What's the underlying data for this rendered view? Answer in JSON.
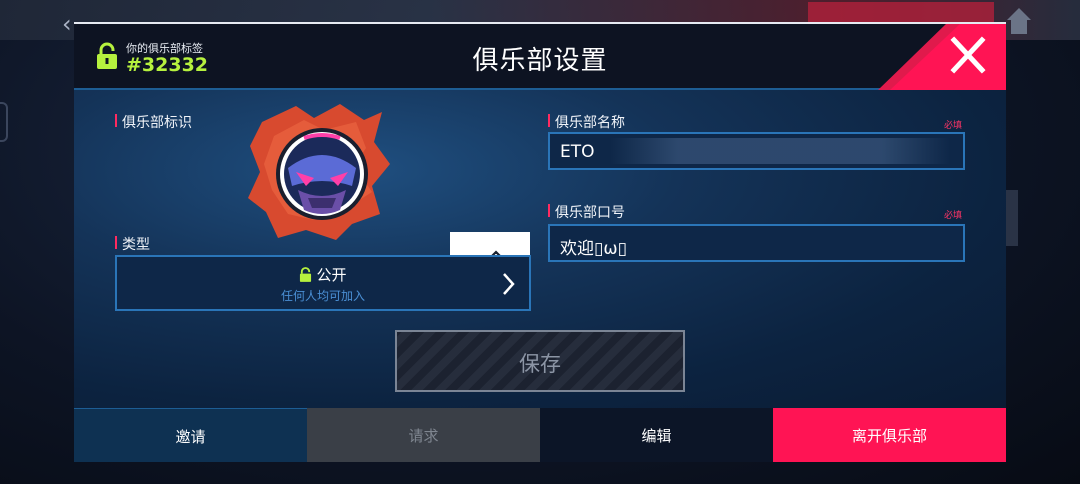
{
  "background": {
    "back_glyph": "‹"
  },
  "header": {
    "tag_label": "你的俱乐部标签",
    "tag_value": "#32332",
    "title": "俱乐部设置",
    "close_icon": "close-x-icon"
  },
  "emblem_section": {
    "label": "俱乐部标识"
  },
  "type_section": {
    "label": "类型",
    "value": "公开",
    "description": "任何人均可加入"
  },
  "name_section": {
    "label": "俱乐部名称",
    "required": "必填",
    "value": "ETO"
  },
  "slogan_section": {
    "label": "俱乐部口号",
    "required": "必填",
    "value": "欢迎▯ω▯"
  },
  "save_button": {
    "label": "保存",
    "enabled": false
  },
  "tabs": {
    "invite": "邀请",
    "request": "请求",
    "edit": "编辑",
    "leave": "离开俱乐部"
  },
  "colors": {
    "accent_lime": "#b6f13e",
    "accent_pink": "#ff1454",
    "field_border": "#2a75b8",
    "panel_bg": "#0b1a2e"
  }
}
